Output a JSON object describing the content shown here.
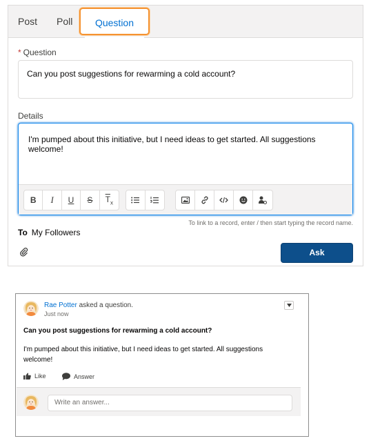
{
  "composer": {
    "tabs": [
      {
        "label": "Post"
      },
      {
        "label": "Poll"
      },
      {
        "label": "Question"
      }
    ],
    "question": {
      "required_mark": "*",
      "label": "Question",
      "value": "Can you post suggestions for rewarming a cold account?"
    },
    "details": {
      "label": "Details",
      "value": "I'm pumped about this initiative, but I need ideas to get started. All suggestions welcome!"
    },
    "toolbar": {
      "bold": "B",
      "italic": "I",
      "underline": "U",
      "strikethrough": "S",
      "clear_format": "T",
      "clear_format_sub": "x"
    },
    "hint": "To link to a record, enter / then start typing the record name.",
    "to_label": "To",
    "to_value": "My Followers",
    "ask_label": "Ask"
  },
  "feed_item": {
    "author": "Rae Potter",
    "action": "asked a question.",
    "time": "Just now",
    "title": "Can you post suggestions for rewarming a cold account?",
    "body": "I'm pumped about this initiative, but I need ideas to get started. All suggestions welcome!",
    "like_label": "Like",
    "answer_label": "Answer",
    "answer_placeholder": "Write an answer..."
  },
  "colors": {
    "accent": "#0070d2",
    "ask_button": "#0d4f8b",
    "tab_highlight": "#f59331",
    "required": "#c23934"
  }
}
